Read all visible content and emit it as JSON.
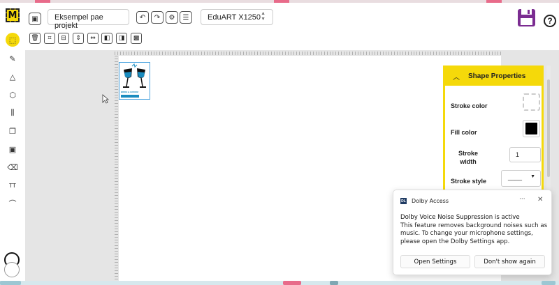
{
  "header": {
    "logo_letter": "M",
    "project_name": "Eksempel pae projekt",
    "machine": "EduART X1250",
    "help_label": "?"
  },
  "toolbar_icons": [
    "delete-icon",
    "group-icon",
    "align-icon",
    "distribute-icon",
    "flip-icon",
    "bring-front-icon",
    "send-back-icon",
    "pattern-icon"
  ],
  "side_tools": [
    "select-icon",
    "pen-icon",
    "shapes-icon",
    "3d-box-icon",
    "align-tool-icon",
    "copy-icon",
    "frame-icon",
    "eraser-icon",
    "text-icon",
    "path-icon"
  ],
  "shape_properties": {
    "title": "Shape Properties",
    "stroke_color_label": "Stroke color",
    "fill_color_label": "Fill color",
    "stroke_width_label": "Stroke width",
    "stroke_width_value": "1",
    "stroke_style_label": "Stroke style",
    "stroke_style_value": "____",
    "fill_color": "#000000"
  },
  "design_caption": "BRIDE & GROOM",
  "notification": {
    "app_name": "Dolby Access",
    "app_icon_text": "DL",
    "title": "Dolby Voice Noise Suppression is active",
    "body": "This feature removes background noises such as music. To change your microphone settings, please open the Dolby Settings app.",
    "more_label": "···",
    "close_label": "✕",
    "primary_button": "Open Settings",
    "secondary_button": "Don't show again"
  },
  "colors": {
    "accent": "#f5d90a",
    "save_icon": "#7b2c91",
    "selection": "#4aa3df",
    "design_color": "#1a8cbf"
  }
}
